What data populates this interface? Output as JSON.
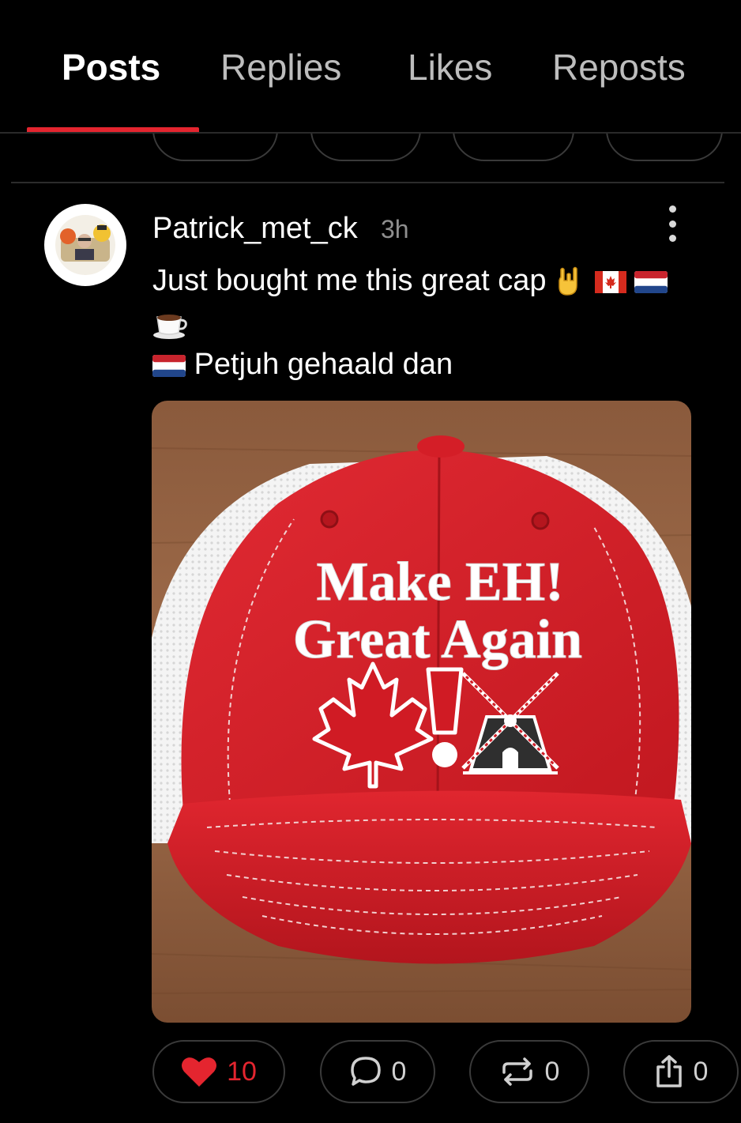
{
  "tabs": [
    {
      "label": "Posts",
      "active": true
    },
    {
      "label": "Replies",
      "active": false
    },
    {
      "label": "Likes",
      "active": false
    },
    {
      "label": "Reposts",
      "active": false
    }
  ],
  "post": {
    "username": "Patrick_met_ck",
    "time": "3h",
    "text_line1": "Just bought me this great cap",
    "text_line1_emojis": [
      "sign-of-the-horns",
      "flag-canada",
      "flag-netherlands"
    ],
    "text_line2_emoji": "hot-beverage",
    "text_line3_emoji": "flag-netherlands",
    "text_line3": "Petjuh gehaald dan",
    "image": {
      "subject": "red trucker cap with white mesh",
      "embroidery_line1": "Make EH!",
      "embroidery_line2": "Great Again"
    },
    "actions": {
      "likes": "10",
      "replies": "0",
      "reposts": "0",
      "shares": "0"
    }
  },
  "colors": {
    "accent": "#e4252f",
    "background": "#000000",
    "cap_red": "#d71f28"
  },
  "icons": [
    "heart-icon",
    "comment-icon",
    "repost-icon",
    "share-icon",
    "more-options-icon"
  ]
}
